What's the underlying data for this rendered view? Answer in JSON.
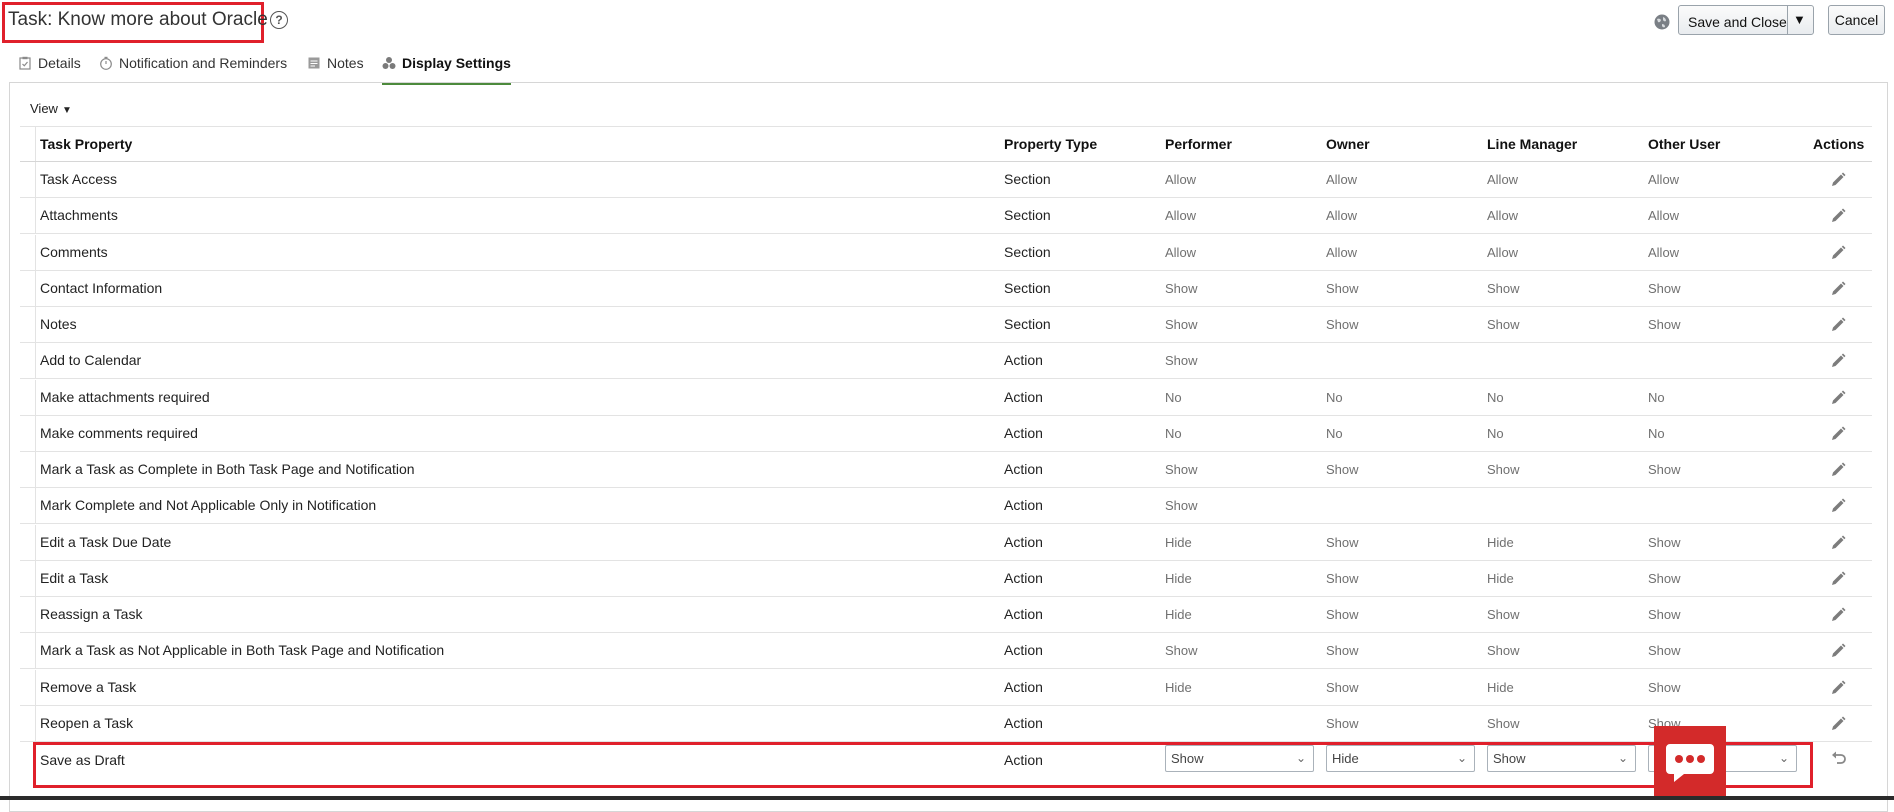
{
  "header": {
    "title": "Task: Know more about Oracle",
    "help_icon": "?",
    "save_close_label": "Save and Close",
    "save_menu_caret": "▼",
    "cancel_label": "Cancel"
  },
  "tabs": [
    {
      "label": "Details",
      "icon": "clipboard-icon",
      "active": false
    },
    {
      "label": "Notification and Reminders",
      "icon": "stopwatch-icon",
      "active": false
    },
    {
      "label": "Notes",
      "icon": "note-icon",
      "active": false
    },
    {
      "label": "Display Settings",
      "icon": "circles-icon",
      "active": true
    }
  ],
  "view_menu": {
    "label": "View",
    "caret": "▼"
  },
  "table": {
    "columns": [
      "Task Property",
      "Property Type",
      "Performer",
      "Owner",
      "Line Manager",
      "Other User",
      "Actions"
    ],
    "rows": [
      [
        "Task Access",
        "Section",
        "Allow",
        "Allow",
        "Allow",
        "Allow"
      ],
      [
        "Attachments",
        "Section",
        "Allow",
        "Allow",
        "Allow",
        "Allow"
      ],
      [
        "Comments",
        "Section",
        "Allow",
        "Allow",
        "Allow",
        "Allow"
      ],
      [
        "Contact Information",
        "Section",
        "Show",
        "Show",
        "Show",
        "Show"
      ],
      [
        "Notes",
        "Section",
        "Show",
        "Show",
        "Show",
        "Show"
      ],
      [
        "Add to Calendar",
        "Action",
        "Show",
        "",
        "",
        ""
      ],
      [
        "Make attachments required",
        "Action",
        "No",
        "No",
        "No",
        "No"
      ],
      [
        "Make comments required",
        "Action",
        "No",
        "No",
        "No",
        "No"
      ],
      [
        "Mark a Task as Complete in Both Task Page and Notification",
        "Action",
        "Show",
        "Show",
        "Show",
        "Show"
      ],
      [
        "Mark Complete and Not Applicable Only in Notification",
        "Action",
        "Show",
        "",
        "",
        ""
      ],
      [
        "Edit a Task Due Date",
        "Action",
        "Hide",
        "Show",
        "Hide",
        "Show"
      ],
      [
        "Edit a Task",
        "Action",
        "Hide",
        "Show",
        "Hide",
        "Show"
      ],
      [
        "Reassign a Task",
        "Action",
        "Hide",
        "Show",
        "Show",
        "Show"
      ],
      [
        "Mark a Task as Not Applicable in Both Task Page and Notification",
        "Action",
        "Show",
        "Show",
        "Show",
        "Show"
      ],
      [
        "Remove a Task",
        "Action",
        "Hide",
        "Show",
        "Hide",
        "Show"
      ],
      [
        "Reopen a Task",
        "Action",
        "",
        "Show",
        "Show",
        "Show"
      ]
    ],
    "editing_row": {
      "property": "Save as Draft",
      "type": "Action",
      "performer": "Show",
      "owner": "Hide",
      "line_manager": "Show",
      "other_user": ""
    }
  },
  "colors": {
    "highlight": "#e0202b",
    "active_tab_underline": "#4d8a3c",
    "chat_button": "#d32a2a"
  }
}
